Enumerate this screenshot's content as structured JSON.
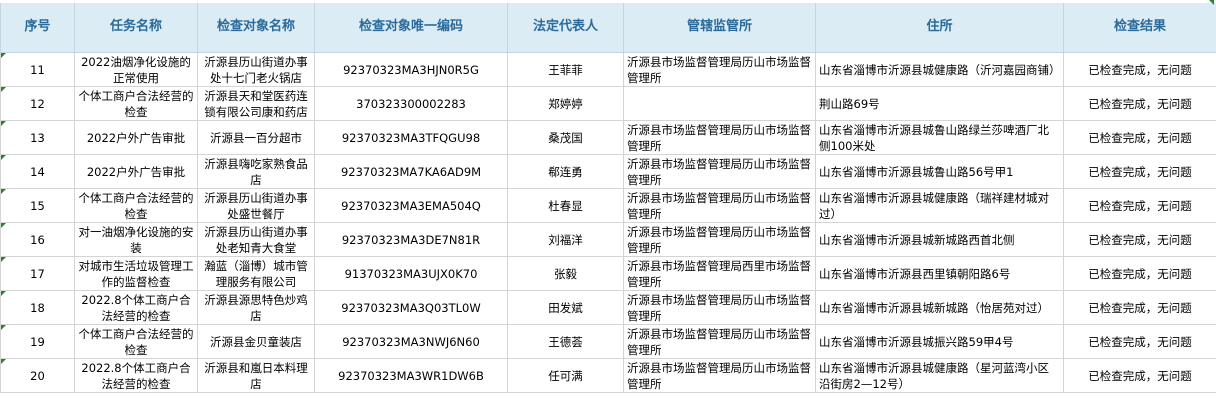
{
  "columns": {
    "seq": "序号",
    "task": "任务名称",
    "target_name": "检查对象名称",
    "target_code": "检查对象唯一编码",
    "legal_rep": "法定代表人",
    "authority": "管辖监管所",
    "address": "住所",
    "result": "检查结果"
  },
  "rows": [
    {
      "seq": "11",
      "task": "2022油烟净化设施的正常使用",
      "target_name": "沂源县历山街道办事处十七门老火锅店",
      "target_code": "92370323MA3HJN0R5G",
      "legal_rep": "王菲菲",
      "authority": "沂源县市场监督管理局历山市场监督管理所",
      "address": "山东省淄博市沂源县城健康路（沂河嘉园商铺）",
      "result": "已检查完成，无问题"
    },
    {
      "seq": "12",
      "task": "个体工商户合法经营的检查",
      "target_name": "沂源县天和堂医药连锁有限公司康和药店",
      "target_code": "370323300002283",
      "legal_rep": "郑婷婷",
      "authority": "",
      "address": "荆山路69号",
      "result": "已检查完成，无问题"
    },
    {
      "seq": "13",
      "task": "2022户外广告审批",
      "target_name": "沂源县一百分超市",
      "target_code": "92370323MA3TFQGU98",
      "legal_rep": "桑茂国",
      "authority": "沂源县市场监督管理局历山市场监督管理所",
      "address": "山东省淄博市沂源县城鲁山路绿兰莎啤酒厂北侧100米处",
      "result": "已检查完成，无问题"
    },
    {
      "seq": "14",
      "task": "2022户外广告审批",
      "target_name": "沂源县嗨吃家熟食品店",
      "target_code": "92370323MA7KA6AD9M",
      "legal_rep": "郗连勇",
      "authority": "沂源县市场监督管理局历山市场监督管理所",
      "address": "山东省淄博市沂源县城鲁山路56号甲1",
      "result": "已检查完成，无问题"
    },
    {
      "seq": "15",
      "task": "个体工商户合法经营的检查",
      "target_name": "沂源县历山街道办事处盛世餐厅",
      "target_code": "92370323MA3EMA504Q",
      "legal_rep": "杜春显",
      "authority": "沂源县市场监督管理局历山市场监督管理所",
      "address": "山东省淄博市沂源县城健康路（瑞祥建材城对过）",
      "result": "已检查完成，无问题"
    },
    {
      "seq": "16",
      "task": "对一油烟净化设施的安装",
      "target_name": "沂源县历山街道办事处老知青大食堂",
      "target_code": "92370323MA3DE7N81R",
      "legal_rep": "刘福洋",
      "authority": "沂源县市场监督管理局历山市场监督管理所",
      "address": "山东省淄博市沂源县城新城路西首北侧",
      "result": "已检查完成，无问题"
    },
    {
      "seq": "17",
      "task": "对城市生活垃圾管理工作的监督检查",
      "target_name": "瀚蓝（淄博）城市管理服务有限公司",
      "target_code": "91370323MA3UJX0K70",
      "legal_rep": "张毅",
      "authority": "沂源县市场监督管理局西里市场监督管理所",
      "address": "山东省淄博市沂源县西里镇朝阳路6号",
      "result": "已检查完成，无问题"
    },
    {
      "seq": "18",
      "task": "2022.8个体工商户合法经营的检查",
      "target_name": "沂源县源思特色炒鸡店",
      "target_code": "92370323MA3Q03TL0W",
      "legal_rep": "田发斌",
      "authority": "沂源县市场监督管理局历山市场监督管理所",
      "address": "山东省淄博市沂源县城新城路（怡居苑对过）",
      "result": "已检查完成，无问题"
    },
    {
      "seq": "19",
      "task": "个体工商户合法经营的检查",
      "target_name": "沂源县金贝童装店",
      "target_code": "92370323MA3NWJ6N60",
      "legal_rep": "王德荟",
      "authority": "沂源县市场监督管理局历山市场监督管理所",
      "address": "山东省淄博市沂源县城振兴路59甲4号",
      "result": "已检查完成，无问题"
    },
    {
      "seq": "20",
      "task": "2022.8个体工商户合法经营的检查",
      "target_name": "沂源县和嵐日本料理店",
      "target_code": "92370323MA3WR1DW6B",
      "legal_rep": "任可满",
      "authority": "沂源县市场监督管理局历山市场监督管理所",
      "address": "山东省淄博市沂源县城健康路（星河蓝湾小区沿街房2—12号）",
      "result": "已检查完成，无问题"
    }
  ],
  "colors": {
    "header_bg": "#dcecf5",
    "header_text": "#2a6b9c",
    "cell_marker": "#1e8a2f",
    "grid": "#d4d4d4"
  }
}
